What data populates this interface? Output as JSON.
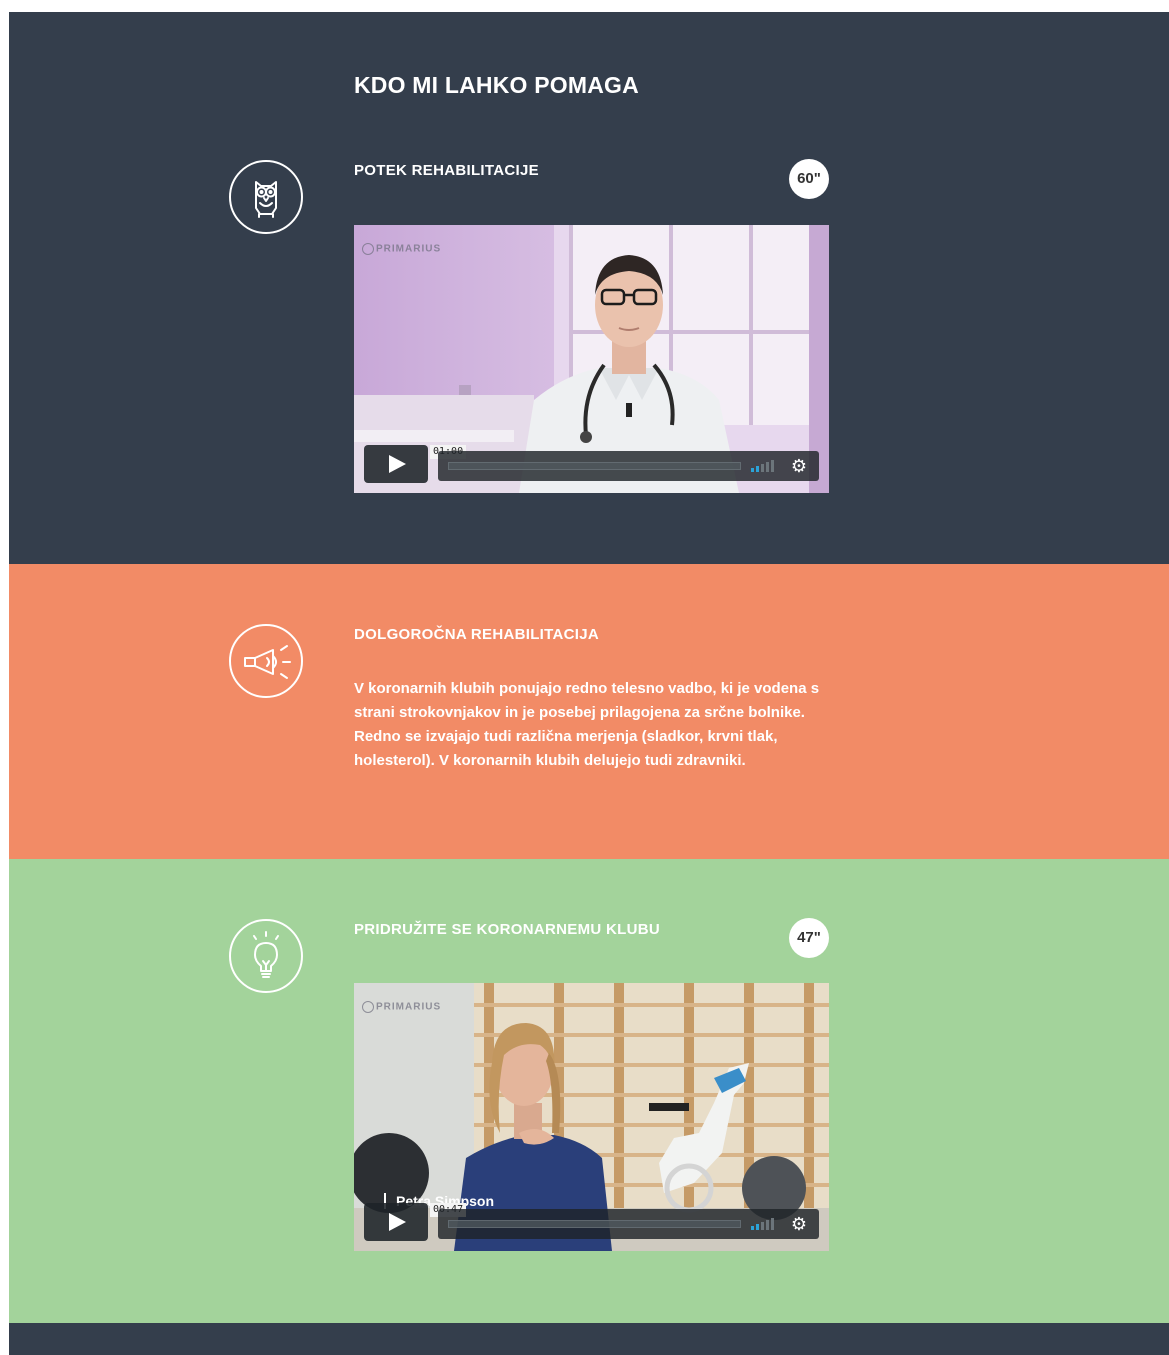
{
  "page": {
    "title": "KDO MI LAHKO POMAGA"
  },
  "sections": [
    {
      "icon": "owl-icon",
      "title": "POTEK REHABILITACIJE",
      "duration": "60\"",
      "video": {
        "watermark": "PRIMARIUS",
        "time": "01:00",
        "volume_level": 0.4
      }
    },
    {
      "icon": "megaphone-icon",
      "title": "DOLGOROČNA REHABILITACIJA",
      "text": "V koronarnih klubih ponujajo redno telesno vadbo, ki je vodena s strani strokovnjakov in je posebej prilagojena za srčne bolnike. Redno se izvajajo tudi različna merjenja (sladkor, krvni tlak, holesterol). V koronarnih klubih delujejo tudi zdravniki."
    },
    {
      "icon": "lightbulb-icon",
      "title": "PRIDRUŽITE SE KORONARNEMU KLUBU",
      "duration": "47\"",
      "video": {
        "watermark": "PRIMARIUS",
        "time": "00:47",
        "caption": "Petra Simpson",
        "volume_level": 0.4
      }
    }
  ],
  "colors": {
    "dark": "#343e4c",
    "orange": "#f28b66",
    "green": "#a3d39b",
    "volume_accent": "#2ba3d8"
  }
}
